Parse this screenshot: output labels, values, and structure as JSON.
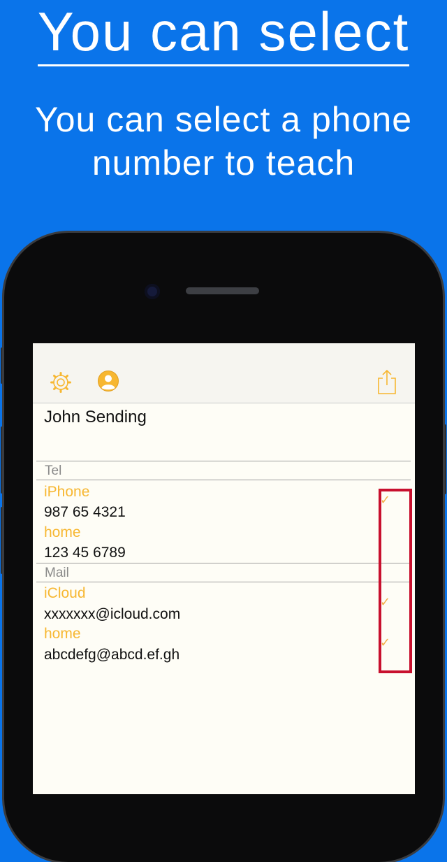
{
  "headline": "You can select",
  "subhead": {
    "line1": "You can select a phone",
    "line2": "number to teach"
  },
  "toolbar": {
    "settings_icon": "gear-icon",
    "contact_icon": "person-icon",
    "share_icon": "share-icon"
  },
  "contact": {
    "name": "John Sending",
    "sections": [
      {
        "header": "Tel",
        "entries": [
          {
            "label": "iPhone",
            "value": "987 65 4321",
            "checked": true
          },
          {
            "label": "home",
            "value": "123 45 6789",
            "checked": false
          }
        ]
      },
      {
        "header": "Mail",
        "entries": [
          {
            "label": "iCloud",
            "value": "xxxxxxx@icloud.com",
            "checked": true
          },
          {
            "label": "home",
            "value": "abcdefg@abcd.ef.gh",
            "checked": true
          }
        ]
      }
    ]
  },
  "check_glyph": "✓",
  "colors": {
    "background": "#0a74ea",
    "accent": "#f7b731",
    "highlight": "#c8102e"
  }
}
